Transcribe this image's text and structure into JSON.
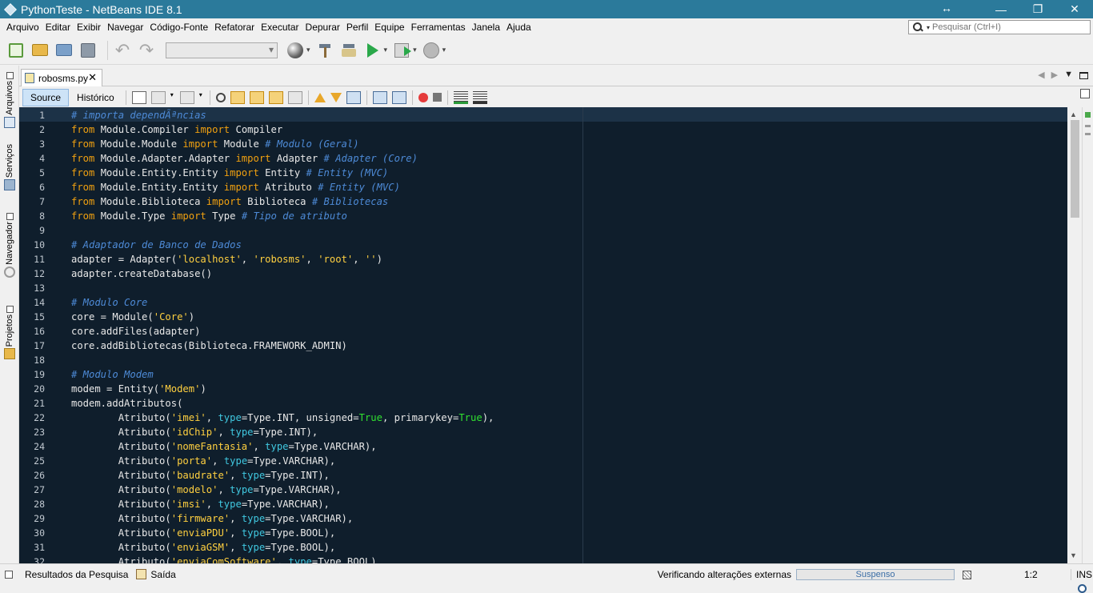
{
  "window": {
    "title": "PythonTeste - NetBeans IDE 8.1",
    "buttons": [
      "—",
      "❐",
      "✕"
    ],
    "resize_glyph": "↔"
  },
  "menu": [
    "Arquivo",
    "Editar",
    "Exibir",
    "Navegar",
    "Código-Fonte",
    "Refatorar",
    "Executar",
    "Depurar",
    "Perfil",
    "Equipe",
    "Ferramentas",
    "Janela",
    "Ajuda"
  ],
  "search": {
    "placeholder": "Pesquisar (Ctrl+I)",
    "value": ""
  },
  "toolbar": {
    "icons": [
      "new-project-icon",
      "new-file-icon",
      "open-project-icon",
      "save-all-icon",
      "undo-icon",
      "redo-icon",
      "globe-icon",
      "build-icon",
      "clean-build-icon",
      "run-icon",
      "debug-icon",
      "profile-icon"
    ],
    "config_value": ""
  },
  "side_tabs": [
    "Arquivos",
    "Serviços",
    "Navegador",
    "Projetos"
  ],
  "editor": {
    "tab_name": "robosms.py",
    "source_label": "Source",
    "history_label": "Histórico",
    "active_view": "Source"
  },
  "code_lines": [
    [
      [
        "cm",
        "# importa dependÃªncias"
      ]
    ],
    [
      [
        "kw",
        "from"
      ],
      [
        "",
        " Module.Compiler "
      ],
      [
        "kw",
        "import"
      ],
      [
        "",
        " Compiler"
      ]
    ],
    [
      [
        "kw",
        "from"
      ],
      [
        "",
        " Module.Module "
      ],
      [
        "kw",
        "import"
      ],
      [
        "",
        " Module "
      ],
      [
        "cm",
        "# Modulo (Geral)"
      ]
    ],
    [
      [
        "kw",
        "from"
      ],
      [
        "",
        " Module.Adapter.Adapter "
      ],
      [
        "kw",
        "import"
      ],
      [
        "",
        " Adapter "
      ],
      [
        "cm",
        "# Adapter (Core)"
      ]
    ],
    [
      [
        "kw",
        "from"
      ],
      [
        "",
        " Module.Entity.Entity "
      ],
      [
        "kw",
        "import"
      ],
      [
        "",
        " Entity "
      ],
      [
        "cm",
        "# Entity (MVC)"
      ]
    ],
    [
      [
        "kw",
        "from"
      ],
      [
        "",
        " Module.Entity.Entity "
      ],
      [
        "kw",
        "import"
      ],
      [
        "",
        " Atributo "
      ],
      [
        "cm",
        "# Entity (MVC)"
      ]
    ],
    [
      [
        "kw",
        "from"
      ],
      [
        "",
        " Module.Biblioteca "
      ],
      [
        "kw",
        "import"
      ],
      [
        "",
        " Biblioteca "
      ],
      [
        "cm",
        "# Bibliotecas"
      ]
    ],
    [
      [
        "kw",
        "from"
      ],
      [
        "",
        " Module.Type "
      ],
      [
        "kw",
        "import"
      ],
      [
        "",
        " Type "
      ],
      [
        "cm",
        "# Tipo de atributo"
      ]
    ],
    [],
    [
      [
        "cm",
        "# Adaptador de Banco de Dados"
      ]
    ],
    [
      [
        "",
        "adapter = Adapter("
      ],
      [
        "st",
        "'localhost'"
      ],
      [
        "",
        ", "
      ],
      [
        "st",
        "'robosms'"
      ],
      [
        "",
        ", "
      ],
      [
        "st",
        "'root'"
      ],
      [
        "",
        ", "
      ],
      [
        "st",
        "''"
      ],
      [
        "",
        ")"
      ]
    ],
    [
      [
        "",
        "adapter.createDatabase()"
      ]
    ],
    [],
    [
      [
        "cm",
        "# Modulo Core"
      ]
    ],
    [
      [
        "",
        "core = Module("
      ],
      [
        "st",
        "'Core'"
      ],
      [
        "",
        ")"
      ]
    ],
    [
      [
        "",
        "core.addFiles(adapter)"
      ]
    ],
    [
      [
        "",
        "core.addBibliotecas(Biblioteca.FRAMEWORK_ADMIN)"
      ]
    ],
    [],
    [
      [
        "cm",
        "# Modulo Modem"
      ]
    ],
    [
      [
        "",
        "modem = Entity("
      ],
      [
        "st",
        "'Modem'"
      ],
      [
        "",
        ")"
      ]
    ],
    [
      [
        "",
        "modem.addAtributos("
      ]
    ],
    [
      [
        "",
        "        Atributo("
      ],
      [
        "st",
        "'imei'"
      ],
      [
        "",
        ", "
      ],
      [
        "kv",
        "type"
      ],
      [
        "",
        "=Type.INT, unsigned="
      ],
      [
        "bt",
        "True"
      ],
      [
        "",
        ", primarykey="
      ],
      [
        "bt",
        "True"
      ],
      [
        "",
        "),"
      ]
    ],
    [
      [
        "",
        "        Atributo("
      ],
      [
        "st",
        "'idChip'"
      ],
      [
        "",
        ", "
      ],
      [
        "kv",
        "type"
      ],
      [
        "",
        "=Type.INT),"
      ]
    ],
    [
      [
        "",
        "        Atributo("
      ],
      [
        "st",
        "'nomeFantasia'"
      ],
      [
        "",
        ", "
      ],
      [
        "kv",
        "type"
      ],
      [
        "",
        "=Type.VARCHAR),"
      ]
    ],
    [
      [
        "",
        "        Atributo("
      ],
      [
        "st",
        "'porta'"
      ],
      [
        "",
        ", "
      ],
      [
        "kv",
        "type"
      ],
      [
        "",
        "=Type.VARCHAR),"
      ]
    ],
    [
      [
        "",
        "        Atributo("
      ],
      [
        "st",
        "'baudrate'"
      ],
      [
        "",
        ", "
      ],
      [
        "kv",
        "type"
      ],
      [
        "",
        "=Type.INT),"
      ]
    ],
    [
      [
        "",
        "        Atributo("
      ],
      [
        "st",
        "'modelo'"
      ],
      [
        "",
        ", "
      ],
      [
        "kv",
        "type"
      ],
      [
        "",
        "=Type.VARCHAR),"
      ]
    ],
    [
      [
        "",
        "        Atributo("
      ],
      [
        "st",
        "'imsi'"
      ],
      [
        "",
        ", "
      ],
      [
        "kv",
        "type"
      ],
      [
        "",
        "=Type.VARCHAR),"
      ]
    ],
    [
      [
        "",
        "        Atributo("
      ],
      [
        "st",
        "'firmware'"
      ],
      [
        "",
        ", "
      ],
      [
        "kv",
        "type"
      ],
      [
        "",
        "=Type.VARCHAR),"
      ]
    ],
    [
      [
        "",
        "        Atributo("
      ],
      [
        "st",
        "'enviaPDU'"
      ],
      [
        "",
        ", "
      ],
      [
        "kv",
        "type"
      ],
      [
        "",
        "=Type.BOOL),"
      ]
    ],
    [
      [
        "",
        "        Atributo("
      ],
      [
        "st",
        "'enviaGSM'"
      ],
      [
        "",
        ", "
      ],
      [
        "kv",
        "type"
      ],
      [
        "",
        "=Type.BOOL),"
      ]
    ],
    [
      [
        "",
        "        Atributo("
      ],
      [
        "st",
        "'enviaComSoftware'"
      ],
      [
        "",
        ", "
      ],
      [
        "kv",
        "type"
      ],
      [
        "",
        "=Type.BOOL)"
      ]
    ]
  ],
  "statusbar": {
    "search_results": "Resultados da Pesquisa",
    "output": "Saída",
    "status_text": "Verificando alterações externas",
    "progress_label": "Suspenso",
    "progress_fraction": 0.0,
    "caret_position": "1:2",
    "insert_mode": "INS"
  },
  "colors": {
    "editor_bg": "#0f1e2c",
    "keyword": "#f0a010",
    "comment": "#4d8ad6",
    "string": "#ffd040",
    "kwarg": "#40c8e0",
    "boolean": "#30e030",
    "titlebar": "#2b7a9b"
  }
}
